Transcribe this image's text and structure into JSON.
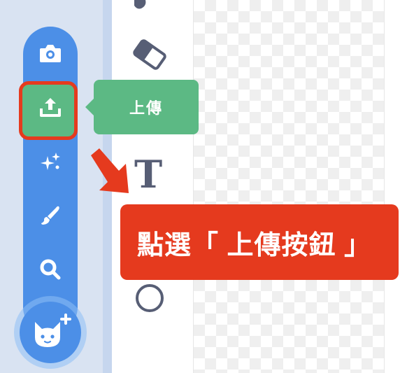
{
  "sprite_menu": {
    "items": [
      {
        "name": "camera-icon"
      },
      {
        "name": "upload-icon"
      },
      {
        "name": "sparkles-icon"
      },
      {
        "name": "paintbrush-icon"
      },
      {
        "name": "search-icon"
      }
    ],
    "main_button": {
      "name": "cat-add-icon"
    }
  },
  "tooltip": {
    "label": "上傳"
  },
  "callout": {
    "text": "點選「 上傳按鈕 」"
  },
  "tools": [
    {
      "name": "eraser-icon"
    },
    {
      "name": "text-tool-icon",
      "glyph": "T"
    },
    {
      "name": "circle-tool-icon"
    }
  ],
  "colors": {
    "menu_blue": "#4c8fe7",
    "highlight_green": "#5cb984",
    "annotation_red": "#e53a1e",
    "tool_gray": "#575e75"
  }
}
